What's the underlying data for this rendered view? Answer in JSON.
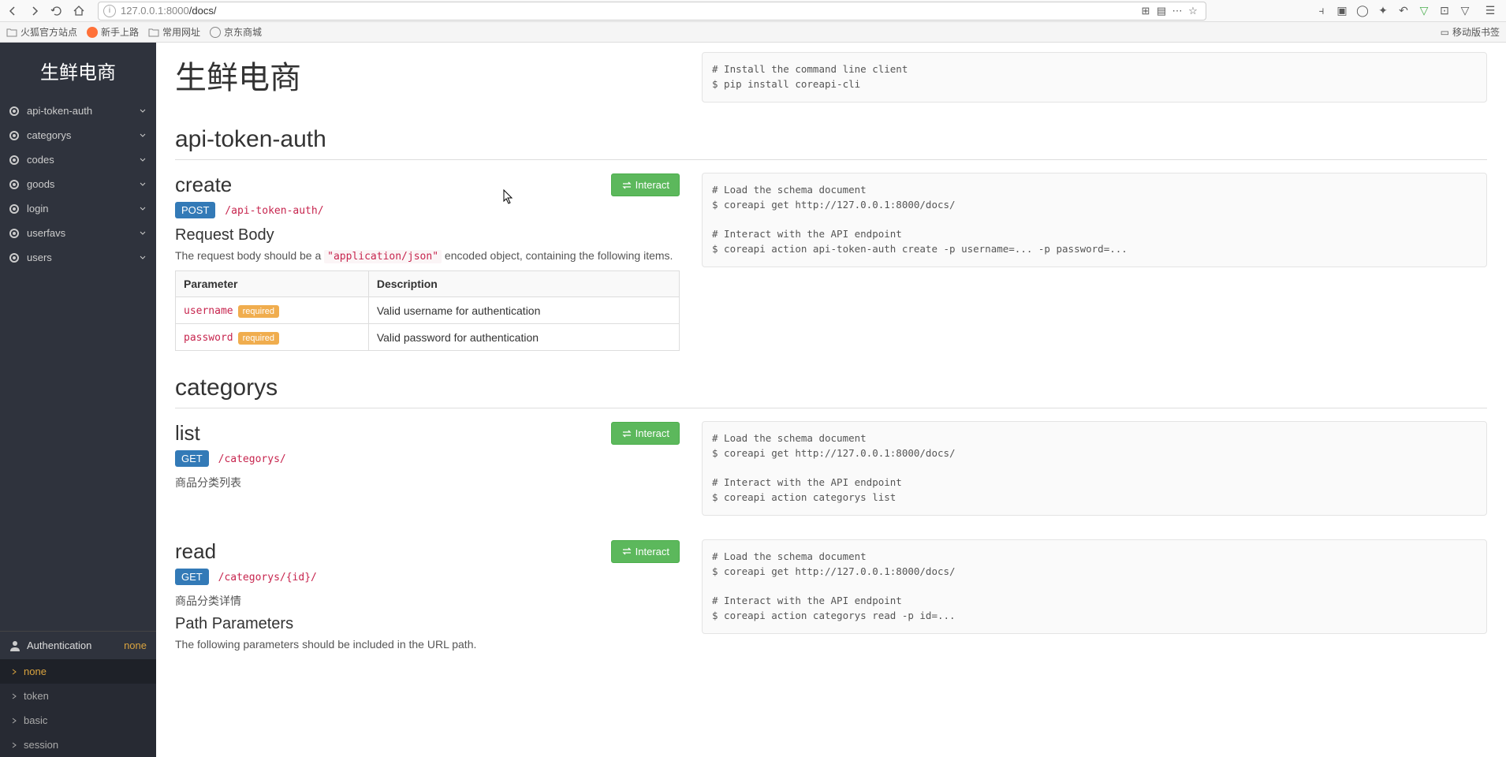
{
  "browser": {
    "url_host": "127.0.0.1",
    "url_port": ":8000",
    "url_path": "/docs/",
    "bookmarks": [
      "火狐官方站点",
      "新手上路",
      "常用网址",
      "京东商城"
    ],
    "mobile_bookmarks": "移动版书签"
  },
  "sidebar": {
    "title": "生鲜电商",
    "items": [
      {
        "label": "api-token-auth"
      },
      {
        "label": "categorys"
      },
      {
        "label": "codes"
      },
      {
        "label": "goods"
      },
      {
        "label": "login"
      },
      {
        "label": "userfavs"
      },
      {
        "label": "users"
      }
    ],
    "auth_label": "Authentication",
    "auth_status": "none",
    "auth_methods": [
      "none",
      "token",
      "basic",
      "session"
    ]
  },
  "page": {
    "title": "生鲜电商",
    "install_code": "# Install the command line client\n$ pip install coreapi-cli",
    "sections": [
      {
        "name": "api-token-auth",
        "endpoints": [
          {
            "name": "create",
            "method": "POST",
            "path": "/api-token-auth/",
            "interact": "Interact",
            "request_body_label": "Request Body",
            "body_desc_pre": "The request body should be a ",
            "body_desc_code": "\"application/json\"",
            "body_desc_post": " encoded object, containing the following items.",
            "table_headers": [
              "Parameter",
              "Description"
            ],
            "params": [
              {
                "name": "username",
                "required": "required",
                "desc": "Valid username for authentication"
              },
              {
                "name": "password",
                "required": "required",
                "desc": "Valid password for authentication"
              }
            ],
            "code": "# Load the schema document\n$ coreapi get http://127.0.0.1:8000/docs/\n\n# Interact with the API endpoint\n$ coreapi action api-token-auth create -p username=... -p password=..."
          }
        ]
      },
      {
        "name": "categorys",
        "endpoints": [
          {
            "name": "list",
            "method": "GET",
            "path": "/categorys/",
            "interact": "Interact",
            "desc": "商品分类列表",
            "code": "# Load the schema document\n$ coreapi get http://127.0.0.1:8000/docs/\n\n# Interact with the API endpoint\n$ coreapi action categorys list"
          },
          {
            "name": "read",
            "method": "GET",
            "path": "/categorys/{id}/",
            "interact": "Interact",
            "desc": "商品分类详情",
            "path_params_label": "Path Parameters",
            "path_params_desc": "The following parameters should be included in the URL path.",
            "code": "# Load the schema document\n$ coreapi get http://127.0.0.1:8000/docs/\n\n# Interact with the API endpoint\n$ coreapi action categorys read -p id=..."
          }
        ]
      }
    ]
  }
}
